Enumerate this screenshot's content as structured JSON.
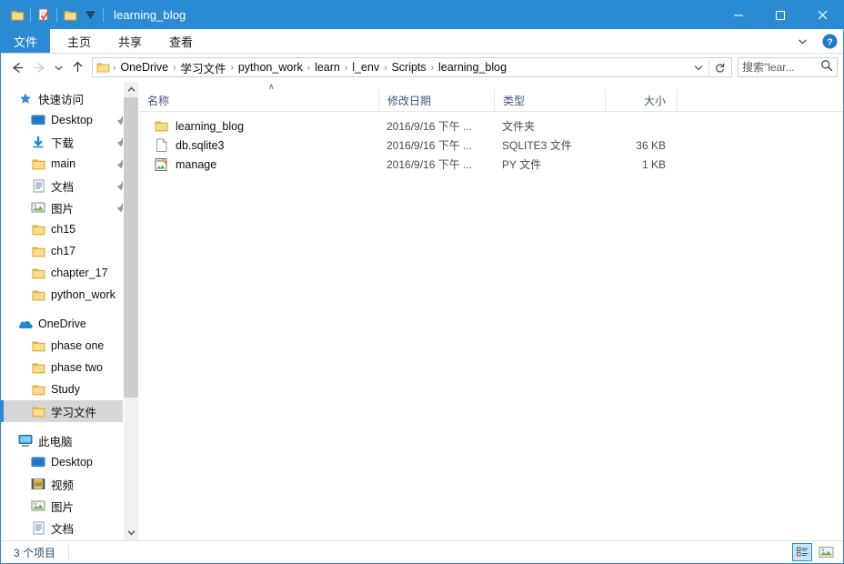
{
  "window": {
    "title": "learning_blog",
    "quick_access_icons": [
      "folder-icon",
      "properties-icon",
      "new-folder-icon",
      "customize-dropdown-icon"
    ],
    "controls": {
      "minimize": "—",
      "maximize": "□",
      "close": "✕"
    }
  },
  "ribbon": {
    "tabs": [
      {
        "label": "文件",
        "active": true
      },
      {
        "label": "主页",
        "active": false
      },
      {
        "label": "共享",
        "active": false
      },
      {
        "label": "查看",
        "active": false
      }
    ],
    "expand_icon": "chevron-down-icon",
    "help_icon": "help-icon"
  },
  "address": {
    "back_icon": "back-arrow-icon",
    "forward_icon": "forward-arrow-icon",
    "recent_icon": "recent-locations-icon",
    "up_icon": "up-arrow-icon",
    "crumbs": [
      "OneDrive",
      "学习文件",
      "python_work",
      "learn",
      "l_env",
      "Scripts",
      "learning_blog"
    ],
    "separator": "›",
    "dropdown_icon": "chevron-down-icon",
    "refresh_icon": "refresh-icon"
  },
  "search": {
    "placeholder": "搜索\"lear...",
    "value": "",
    "icon": "search-icon"
  },
  "sidebar": {
    "groups": [
      {
        "header": {
          "label": "快速访问",
          "icon": "star-pin-icon"
        },
        "items": [
          {
            "label": "Desktop",
            "icon": "desktop-icon",
            "pinned": true,
            "selected": false
          },
          {
            "label": "下载",
            "icon": "downloads-icon",
            "pinned": true,
            "selected": false
          },
          {
            "label": "main",
            "icon": "folder-icon",
            "pinned": true,
            "selected": false
          },
          {
            "label": "文档",
            "icon": "documents-icon",
            "pinned": true,
            "selected": false
          },
          {
            "label": "图片",
            "icon": "pictures-icon",
            "pinned": true,
            "selected": false
          },
          {
            "label": "ch15",
            "icon": "folder-icon",
            "pinned": false,
            "selected": false
          },
          {
            "label": "ch17",
            "icon": "folder-icon",
            "pinned": false,
            "selected": false
          },
          {
            "label": "chapter_17",
            "icon": "folder-icon",
            "pinned": false,
            "selected": false
          },
          {
            "label": "python_work",
            "icon": "folder-icon",
            "pinned": false,
            "selected": false
          }
        ]
      },
      {
        "header": {
          "label": "OneDrive",
          "icon": "onedrive-cloud-icon"
        },
        "items": [
          {
            "label": "phase one",
            "icon": "folder-icon",
            "pinned": false,
            "selected": false
          },
          {
            "label": "phase two",
            "icon": "folder-icon",
            "pinned": false,
            "selected": false
          },
          {
            "label": "Study",
            "icon": "folder-icon",
            "pinned": false,
            "selected": false
          },
          {
            "label": "学习文件",
            "icon": "folder-icon",
            "pinned": false,
            "selected": true
          }
        ]
      },
      {
        "header": {
          "label": "此电脑",
          "icon": "this-pc-icon"
        },
        "items": [
          {
            "label": "Desktop",
            "icon": "desktop-icon",
            "pinned": false,
            "selected": false
          },
          {
            "label": "视频",
            "icon": "videos-icon",
            "pinned": false,
            "selected": false
          },
          {
            "label": "图片",
            "icon": "pictures-icon",
            "pinned": false,
            "selected": false
          },
          {
            "label": "文档",
            "icon": "documents-icon",
            "pinned": false,
            "selected": false
          }
        ]
      }
    ],
    "scroll_up_icon": "scroll-up-arrow-icon",
    "scroll_down_icon": "scroll-down-arrow-icon"
  },
  "filelist": {
    "sort_indicator": "∧",
    "columns": [
      {
        "label": "名称",
        "key": "name"
      },
      {
        "label": "修改日期",
        "key": "date"
      },
      {
        "label": "类型",
        "key": "type"
      },
      {
        "label": "大小",
        "key": "size"
      }
    ],
    "rows": [
      {
        "name": "learning_blog",
        "date": "2016/9/16 下午 ...",
        "type": "文件夹",
        "size": "",
        "icon": "folder-icon"
      },
      {
        "name": "db.sqlite3",
        "date": "2016/9/16 下午 ...",
        "type": "SQLITE3 文件",
        "size": "36 KB",
        "icon": "blank-document-icon"
      },
      {
        "name": "manage",
        "date": "2016/9/16 下午 ...",
        "type": "PY 文件",
        "size": "1 KB",
        "icon": "python-file-icon"
      }
    ]
  },
  "statusbar": {
    "item_count": "3 个项目",
    "views": [
      {
        "name": "details-view",
        "active": true
      },
      {
        "name": "large-icons-view",
        "active": false
      }
    ]
  },
  "colors": {
    "titlebar": "#2a8ad4",
    "accent": "#2a8ad4",
    "selection": "#d6d6d6",
    "hover": "#e8f2fb",
    "folder": "#fcd77f",
    "header_text": "#3b5a7a"
  }
}
